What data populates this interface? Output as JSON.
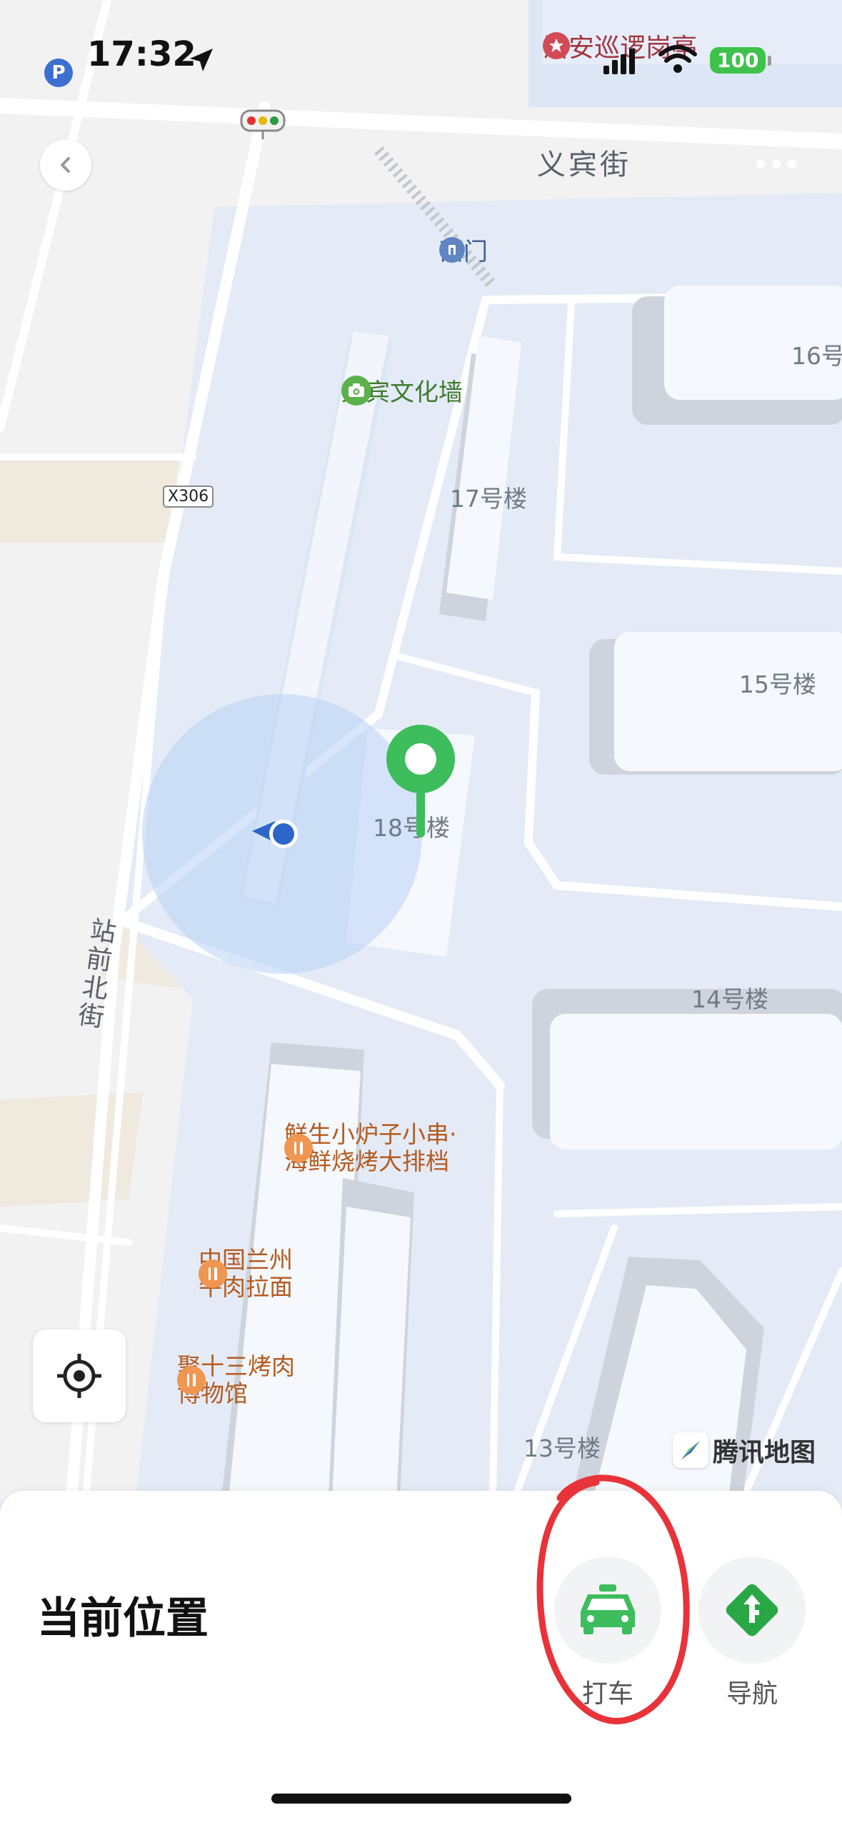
{
  "status_bar": {
    "time": "17:32",
    "battery": "100",
    "parking_badge": "P"
  },
  "map": {
    "roads": [
      {
        "name": "义宾街"
      },
      {
        "name": "X306"
      },
      {
        "name": "站前北街",
        "chars": [
          "站",
          "前",
          "北",
          "街"
        ]
      }
    ],
    "buildings": [
      "16号",
      "17号楼",
      "15号楼",
      "18号楼",
      "14号楼",
      "13号楼"
    ],
    "pois": [
      {
        "name": "治安巡逻岗亭",
        "type": "police"
      },
      {
        "name": "西门",
        "type": "gate"
      },
      {
        "name": "义宾文化墙",
        "type": "scenic"
      },
      {
        "name_lines": [
          "鲜生小炉子小串·",
          "海鲜烧烤大排档"
        ],
        "type": "restaurant"
      },
      {
        "name_lines": [
          "中国兰州",
          "牛肉拉面"
        ],
        "type": "restaurant"
      },
      {
        "name_lines": [
          "聚十三烤肉",
          "博物馆"
        ],
        "type": "restaurant"
      }
    ],
    "attribution": "腾讯地图"
  },
  "sheet": {
    "title": "当前位置",
    "actions": [
      {
        "label": "打车",
        "icon": "taxi-icon"
      },
      {
        "label": "导航",
        "icon": "navigation-icon"
      }
    ]
  },
  "colors": {
    "accent_green": "#3dbd5c",
    "nav_green": "#2aa745",
    "location_blue": "#2b66c8",
    "annotation_red": "#e8333a"
  }
}
